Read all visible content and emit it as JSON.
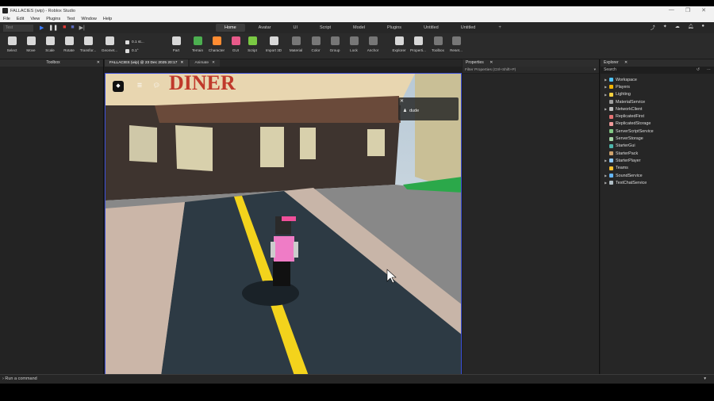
{
  "window": {
    "title": "FALLACIES (wip) - Roblox Studio",
    "controls": [
      "—",
      "❐",
      "✕"
    ]
  },
  "menu": [
    "File",
    "Edit",
    "View",
    "Plugins",
    "Test",
    "Window",
    "Help"
  ],
  "test_mode": "Test",
  "ribbon_tabs": [
    "Home",
    "Avatar",
    "UI",
    "Script",
    "Model",
    "Plugins",
    "Untitled",
    "Untitled"
  ],
  "active_ribbon_tab": "Home",
  "tools": [
    {
      "label": "Select",
      "color": "#d8d8d8"
    },
    {
      "label": "Move",
      "color": "#d8d8d8"
    },
    {
      "label": "Scale",
      "color": "#d8d8d8"
    },
    {
      "label": "Rotate",
      "color": "#d8d8d8"
    },
    {
      "label": "Transfor...",
      "color": "#d8d8d8"
    },
    {
      "label": "Geomet...",
      "color": "#d8d8d8"
    },
    {
      "label": "Part",
      "color": "#d8d8d8"
    },
    {
      "label": "Terrain",
      "color": "#4caf50"
    },
    {
      "label": "Character",
      "color": "#ff8c32"
    },
    {
      "label": "GUI",
      "color": "#e85a8a"
    },
    {
      "label": "Script",
      "color": "#7ac943"
    },
    {
      "label": "Import 3D",
      "color": "#d8d8d8"
    },
    {
      "label": "Material",
      "color": "#777777"
    },
    {
      "label": "Color",
      "color": "#777777"
    },
    {
      "label": "Group",
      "color": "#777777"
    },
    {
      "label": "Lock",
      "color": "#777777"
    },
    {
      "label": "Anchor",
      "color": "#777777"
    },
    {
      "label": "Explorer",
      "color": "#d8d8d8"
    },
    {
      "label": "Properti...",
      "color": "#d8d8d8"
    },
    {
      "label": "Toolbox",
      "color": "#777777"
    },
    {
      "label": "Reset...",
      "color": "#777777"
    }
  ],
  "snap": {
    "move": "0.1 st...",
    "rotate": "0.1°"
  },
  "toolbox": {
    "title": "Toolbox"
  },
  "doc_tabs": [
    {
      "label": "FALLACIES (wip) @ 23 Dec 2025 20:17"
    },
    {
      "label": "Animate"
    }
  ],
  "viewport": {
    "sign_text": "DINER",
    "popup_name": "dude"
  },
  "properties": {
    "title": "Properties",
    "filter_placeholder": "Filter Properties (Ctrl+Shift+P)"
  },
  "explorer": {
    "title": "Explorer",
    "search_placeholder": "Search",
    "items": [
      {
        "name": "Workspace",
        "expandable": true,
        "color": "#4fc3f7"
      },
      {
        "name": "Players",
        "expandable": true,
        "color": "#f4b400"
      },
      {
        "name": "Lighting",
        "expandable": true,
        "color": "#f4d03f"
      },
      {
        "name": "MaterialService",
        "expandable": false,
        "color": "#9e9e9e"
      },
      {
        "name": "NetworkClient",
        "expandable": true,
        "color": "#bdbdbd"
      },
      {
        "name": "ReplicatedFirst",
        "expandable": false,
        "color": "#e57373"
      },
      {
        "name": "ReplicatedStorage",
        "expandable": false,
        "color": "#ef9a9a"
      },
      {
        "name": "ServerScriptService",
        "expandable": false,
        "color": "#81c784"
      },
      {
        "name": "ServerStorage",
        "expandable": false,
        "color": "#a5d6a7"
      },
      {
        "name": "StarterGui",
        "expandable": false,
        "color": "#4db6ac"
      },
      {
        "name": "StarterPack",
        "expandable": false,
        "color": "#cfa26b"
      },
      {
        "name": "StarterPlayer",
        "expandable": true,
        "color": "#90caf9"
      },
      {
        "name": "Teams",
        "expandable": false,
        "color": "#fbc02d"
      },
      {
        "name": "SoundService",
        "expandable": true,
        "color": "#64b5f6"
      },
      {
        "name": "TextChatService",
        "expandable": true,
        "color": "#b0bec5"
      }
    ]
  },
  "command_bar": {
    "placeholder": "Run a command"
  }
}
